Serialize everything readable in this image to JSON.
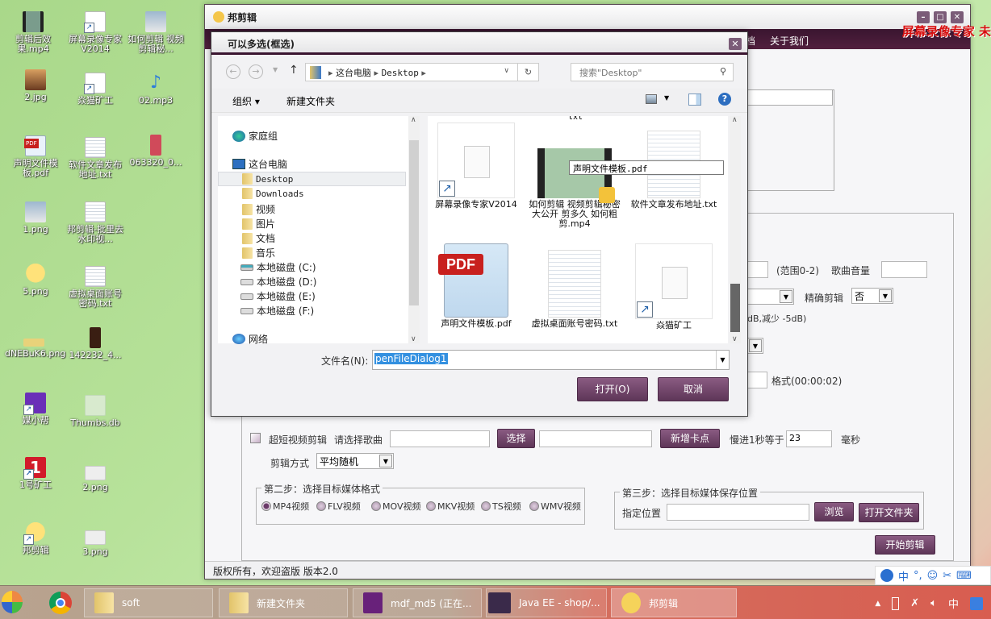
{
  "desktop": {
    "icons": [
      {
        "label": "剪辑后效果.mp4",
        "icon": "video-icon"
      },
      {
        "label": "屏幕录像专家V2014",
        "icon": "shortcut-file-icon"
      },
      {
        "label": "如何剪辑 视频剪辑秘...",
        "icon": "video-icon"
      },
      {
        "label": "2.jpg",
        "icon": "image-icon"
      },
      {
        "label": "焱猫矿工",
        "icon": "shortcut-file-icon"
      },
      {
        "label": "02.mp3",
        "icon": "music-icon"
      },
      {
        "label": "声明文件模板.pdf",
        "icon": "pdf-icon"
      },
      {
        "label": "软件文章发布地址.txt",
        "icon": "text-file-icon"
      },
      {
        "label": "063320_0...",
        "icon": "image-icon"
      },
      {
        "label": "1.png",
        "icon": "image-icon"
      },
      {
        "label": "邦剪辑-批里去水印视...",
        "icon": "text-file-icon"
      },
      {
        "label": "5.png",
        "icon": "image-icon"
      },
      {
        "label": "虚拟桌面账号密码.txt",
        "icon": "text-file-icon"
      },
      {
        "label": "dNEBuK6.png",
        "icon": "image-icon"
      },
      {
        "label": "142232_4...",
        "icon": "image-icon"
      },
      {
        "label": "媒小帮",
        "icon": "app-shortcut-icon"
      },
      {
        "label": "Thumbs.db",
        "icon": "db-file-icon"
      },
      {
        "label": "1号矿工",
        "icon": "app-shortcut-icon"
      },
      {
        "label": "2.png",
        "icon": "image-icon"
      },
      {
        "label": "邦剪辑",
        "icon": "app-shortcut-icon"
      },
      {
        "label": "3.png",
        "icon": "image-icon"
      }
    ]
  },
  "app": {
    "title": "邦剪辑",
    "menu_partial": "档",
    "menu_about": "关于我们",
    "watermark": "屏幕录像专家  未",
    "volume_range_label": "(范围0-2)",
    "song_volume_label": "歌曲音量",
    "precise_cut_label": "精确剪辑",
    "precise_cut_value": "否",
    "db_hint": "dB,减少 -5dB)",
    "time_format_label": "格式(00:00:02)",
    "short_video_label": "超短视频剪辑",
    "choose_song_label": "请选择歌曲",
    "choose_button": "选择",
    "add_beat_button": "新增卡点",
    "slow_label": "慢进1秒等于",
    "slow_value": "23",
    "ms_label": "毫秒",
    "cut_mode_label": "剪辑方式",
    "cut_mode_value": "平均随机",
    "step2_title": "第二步：选择目标媒体格式",
    "formats": [
      {
        "label": "MP4视频",
        "checked": true
      },
      {
        "label": "FLV视频",
        "checked": false
      },
      {
        "label": "MOV视频",
        "checked": false
      },
      {
        "label": "MKV视频",
        "checked": false
      },
      {
        "label": "TS视频",
        "checked": false
      },
      {
        "label": "WMV视频",
        "checked": false
      }
    ],
    "step3_title": "第三步：选择目标媒体保存位置",
    "location_label": "指定位置",
    "location_value": "",
    "browse_button": "浏览",
    "open_folder_button": "打开文件夹",
    "start_button": "开始剪辑",
    "status": "版权所有，欢迎盗版 版本2.0"
  },
  "dialog": {
    "title": "可以多选(框选)",
    "breadcrumb": [
      "这台电脑",
      "Desktop"
    ],
    "search_placeholder": "搜索\"Desktop\"",
    "organize": "组织 ▾",
    "new_folder": "新建文件夹",
    "tree": [
      {
        "label": "家庭组",
        "kind": "homegroup"
      },
      {
        "label": "这台电脑",
        "kind": "computer"
      },
      {
        "label": "Desktop",
        "kind": "folder",
        "selected": true
      },
      {
        "label": "Downloads",
        "kind": "folder"
      },
      {
        "label": "视频",
        "kind": "folder"
      },
      {
        "label": "图片",
        "kind": "folder"
      },
      {
        "label": "文档",
        "kind": "folder"
      },
      {
        "label": "音乐",
        "kind": "folder"
      },
      {
        "label": "本地磁盘 (C:)",
        "kind": "drive"
      },
      {
        "label": "本地磁盘 (D:)",
        "kind": "drive"
      },
      {
        "label": "本地磁盘 (E:)",
        "kind": "drive"
      },
      {
        "label": "本地磁盘 (F:)",
        "kind": "drive"
      },
      {
        "label": "网络",
        "kind": "network"
      }
    ],
    "files": [
      {
        "label": "屏幕录像专家V2014",
        "kind": "shortcut"
      },
      {
        "label": "如何剪辑 视频剪辑秘密大公开 剪多久 如何粗剪.mp4",
        "kind": "video"
      },
      {
        "label": "软件文章发布地址.txt",
        "kind": "text"
      },
      {
        "label": "声明文件模板.pdf",
        "kind": "pdf"
      },
      {
        "label": "虚拟桌面账号密码.txt",
        "kind": "text"
      },
      {
        "label": "焱猫矿工",
        "kind": "shortcut"
      }
    ],
    "top_cut_label": "txt",
    "tooltip": "声明文件模板.pdf",
    "filename_label": "文件名(N):",
    "filename_value": "penFileDialog1",
    "open_button": "打开(O)",
    "cancel_button": "取消"
  },
  "taskbar": {
    "items": [
      {
        "label": "soft",
        "icon": "folder-icon"
      },
      {
        "label": "新建文件夹",
        "icon": "folder-icon"
      },
      {
        "label": "mdf_md5 (正在...",
        "icon": "visual-studio-icon"
      },
      {
        "label": "Java EE - shop/...",
        "icon": "eclipse-icon"
      },
      {
        "label": "邦剪辑",
        "icon": "chick-icon",
        "active": true
      }
    ],
    "ime": "中",
    "tray_lang": "中"
  }
}
